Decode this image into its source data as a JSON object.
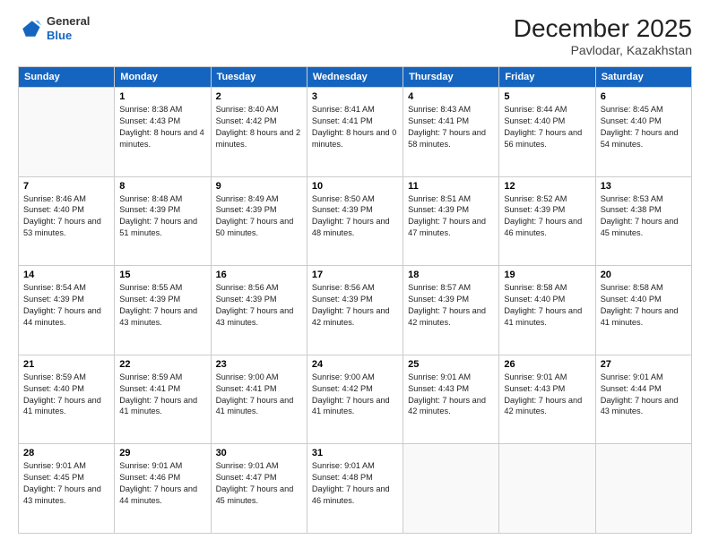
{
  "header": {
    "logo_line1": "General",
    "logo_line2": "Blue",
    "month_title": "December 2025",
    "location": "Pavlodar, Kazakhstan"
  },
  "weekdays": [
    "Sunday",
    "Monday",
    "Tuesday",
    "Wednesday",
    "Thursday",
    "Friday",
    "Saturday"
  ],
  "weeks": [
    [
      {
        "day": "",
        "sunrise": "",
        "sunset": "",
        "daylight": ""
      },
      {
        "day": "1",
        "sunrise": "Sunrise: 8:38 AM",
        "sunset": "Sunset: 4:43 PM",
        "daylight": "Daylight: 8 hours and 4 minutes."
      },
      {
        "day": "2",
        "sunrise": "Sunrise: 8:40 AM",
        "sunset": "Sunset: 4:42 PM",
        "daylight": "Daylight: 8 hours and 2 minutes."
      },
      {
        "day": "3",
        "sunrise": "Sunrise: 8:41 AM",
        "sunset": "Sunset: 4:41 PM",
        "daylight": "Daylight: 8 hours and 0 minutes."
      },
      {
        "day": "4",
        "sunrise": "Sunrise: 8:43 AM",
        "sunset": "Sunset: 4:41 PM",
        "daylight": "Daylight: 7 hours and 58 minutes."
      },
      {
        "day": "5",
        "sunrise": "Sunrise: 8:44 AM",
        "sunset": "Sunset: 4:40 PM",
        "daylight": "Daylight: 7 hours and 56 minutes."
      },
      {
        "day": "6",
        "sunrise": "Sunrise: 8:45 AM",
        "sunset": "Sunset: 4:40 PM",
        "daylight": "Daylight: 7 hours and 54 minutes."
      }
    ],
    [
      {
        "day": "7",
        "sunrise": "Sunrise: 8:46 AM",
        "sunset": "Sunset: 4:40 PM",
        "daylight": "Daylight: 7 hours and 53 minutes."
      },
      {
        "day": "8",
        "sunrise": "Sunrise: 8:48 AM",
        "sunset": "Sunset: 4:39 PM",
        "daylight": "Daylight: 7 hours and 51 minutes."
      },
      {
        "day": "9",
        "sunrise": "Sunrise: 8:49 AM",
        "sunset": "Sunset: 4:39 PM",
        "daylight": "Daylight: 7 hours and 50 minutes."
      },
      {
        "day": "10",
        "sunrise": "Sunrise: 8:50 AM",
        "sunset": "Sunset: 4:39 PM",
        "daylight": "Daylight: 7 hours and 48 minutes."
      },
      {
        "day": "11",
        "sunrise": "Sunrise: 8:51 AM",
        "sunset": "Sunset: 4:39 PM",
        "daylight": "Daylight: 7 hours and 47 minutes."
      },
      {
        "day": "12",
        "sunrise": "Sunrise: 8:52 AM",
        "sunset": "Sunset: 4:39 PM",
        "daylight": "Daylight: 7 hours and 46 minutes."
      },
      {
        "day": "13",
        "sunrise": "Sunrise: 8:53 AM",
        "sunset": "Sunset: 4:38 PM",
        "daylight": "Daylight: 7 hours and 45 minutes."
      }
    ],
    [
      {
        "day": "14",
        "sunrise": "Sunrise: 8:54 AM",
        "sunset": "Sunset: 4:39 PM",
        "daylight": "Daylight: 7 hours and 44 minutes."
      },
      {
        "day": "15",
        "sunrise": "Sunrise: 8:55 AM",
        "sunset": "Sunset: 4:39 PM",
        "daylight": "Daylight: 7 hours and 43 minutes."
      },
      {
        "day": "16",
        "sunrise": "Sunrise: 8:56 AM",
        "sunset": "Sunset: 4:39 PM",
        "daylight": "Daylight: 7 hours and 43 minutes."
      },
      {
        "day": "17",
        "sunrise": "Sunrise: 8:56 AM",
        "sunset": "Sunset: 4:39 PM",
        "daylight": "Daylight: 7 hours and 42 minutes."
      },
      {
        "day": "18",
        "sunrise": "Sunrise: 8:57 AM",
        "sunset": "Sunset: 4:39 PM",
        "daylight": "Daylight: 7 hours and 42 minutes."
      },
      {
        "day": "19",
        "sunrise": "Sunrise: 8:58 AM",
        "sunset": "Sunset: 4:40 PM",
        "daylight": "Daylight: 7 hours and 41 minutes."
      },
      {
        "day": "20",
        "sunrise": "Sunrise: 8:58 AM",
        "sunset": "Sunset: 4:40 PM",
        "daylight": "Daylight: 7 hours and 41 minutes."
      }
    ],
    [
      {
        "day": "21",
        "sunrise": "Sunrise: 8:59 AM",
        "sunset": "Sunset: 4:40 PM",
        "daylight": "Daylight: 7 hours and 41 minutes."
      },
      {
        "day": "22",
        "sunrise": "Sunrise: 8:59 AM",
        "sunset": "Sunset: 4:41 PM",
        "daylight": "Daylight: 7 hours and 41 minutes."
      },
      {
        "day": "23",
        "sunrise": "Sunrise: 9:00 AM",
        "sunset": "Sunset: 4:41 PM",
        "daylight": "Daylight: 7 hours and 41 minutes."
      },
      {
        "day": "24",
        "sunrise": "Sunrise: 9:00 AM",
        "sunset": "Sunset: 4:42 PM",
        "daylight": "Daylight: 7 hours and 41 minutes."
      },
      {
        "day": "25",
        "sunrise": "Sunrise: 9:01 AM",
        "sunset": "Sunset: 4:43 PM",
        "daylight": "Daylight: 7 hours and 42 minutes."
      },
      {
        "day": "26",
        "sunrise": "Sunrise: 9:01 AM",
        "sunset": "Sunset: 4:43 PM",
        "daylight": "Daylight: 7 hours and 42 minutes."
      },
      {
        "day": "27",
        "sunrise": "Sunrise: 9:01 AM",
        "sunset": "Sunset: 4:44 PM",
        "daylight": "Daylight: 7 hours and 43 minutes."
      }
    ],
    [
      {
        "day": "28",
        "sunrise": "Sunrise: 9:01 AM",
        "sunset": "Sunset: 4:45 PM",
        "daylight": "Daylight: 7 hours and 43 minutes."
      },
      {
        "day": "29",
        "sunrise": "Sunrise: 9:01 AM",
        "sunset": "Sunset: 4:46 PM",
        "daylight": "Daylight: 7 hours and 44 minutes."
      },
      {
        "day": "30",
        "sunrise": "Sunrise: 9:01 AM",
        "sunset": "Sunset: 4:47 PM",
        "daylight": "Daylight: 7 hours and 45 minutes."
      },
      {
        "day": "31",
        "sunrise": "Sunrise: 9:01 AM",
        "sunset": "Sunset: 4:48 PM",
        "daylight": "Daylight: 7 hours and 46 minutes."
      },
      {
        "day": "",
        "sunrise": "",
        "sunset": "",
        "daylight": ""
      },
      {
        "day": "",
        "sunrise": "",
        "sunset": "",
        "daylight": ""
      },
      {
        "day": "",
        "sunrise": "",
        "sunset": "",
        "daylight": ""
      }
    ]
  ]
}
